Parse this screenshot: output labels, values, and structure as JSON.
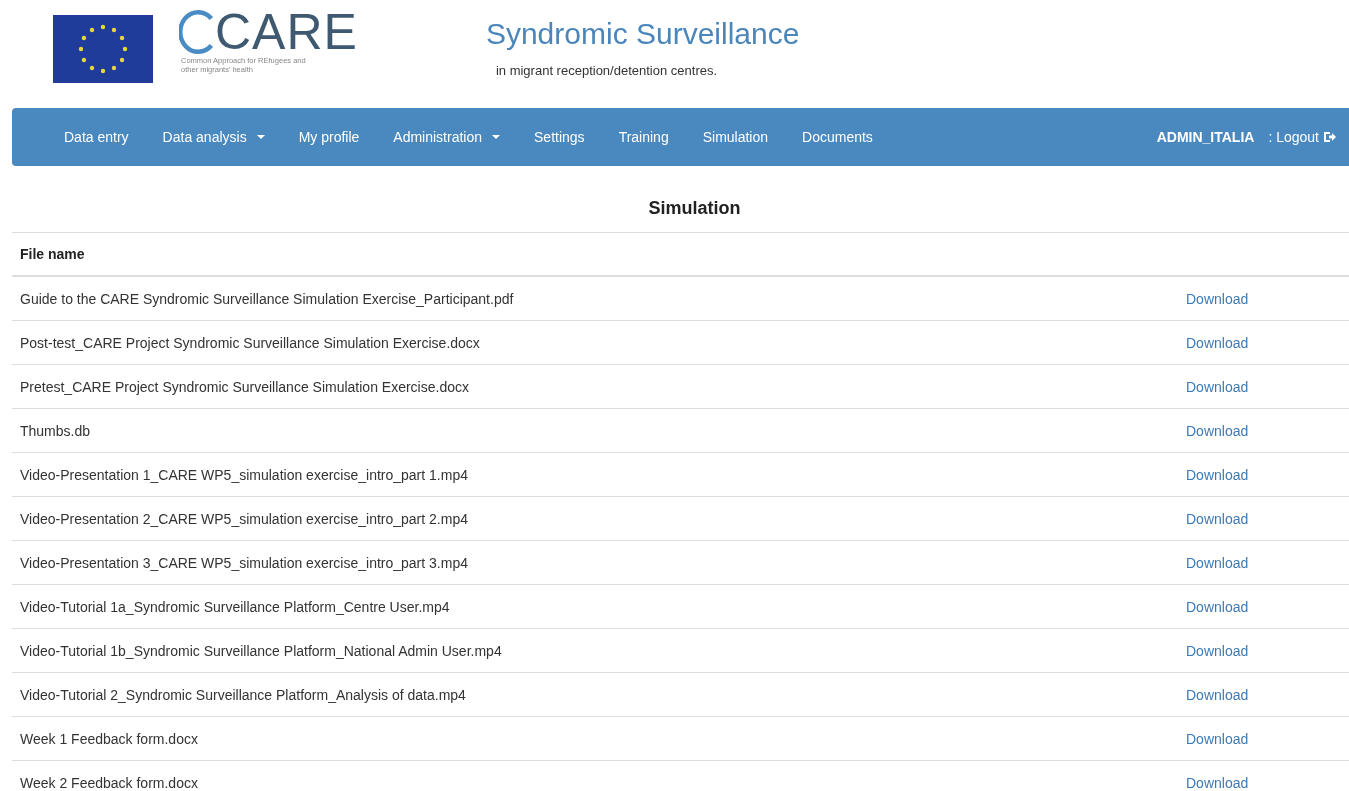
{
  "header": {
    "logo_name": "CARE",
    "logo_tagline": "Common Approach for REfugees and other migrants' health",
    "title": "Syndromic Surveillance",
    "subtitle": "in migrant reception/detention centres."
  },
  "nav": {
    "items": [
      {
        "label": "Data entry",
        "dropdown": false
      },
      {
        "label": "Data analysis",
        "dropdown": true
      },
      {
        "label": "My profile",
        "dropdown": false
      },
      {
        "label": "Administration",
        "dropdown": true
      },
      {
        "label": "Settings",
        "dropdown": false
      },
      {
        "label": "Training",
        "dropdown": false
      },
      {
        "label": "Simulation",
        "dropdown": false
      },
      {
        "label": "Documents",
        "dropdown": false
      }
    ],
    "user": "ADMIN_ITALIA",
    "logout": ": Logout"
  },
  "page_title": "Simulation",
  "table": {
    "columns": [
      "File name"
    ],
    "rows": [
      {
        "file": "Guide to the CARE Syndromic Surveillance Simulation Exercise_Participant.pdf",
        "action": "Download"
      },
      {
        "file": "Post-test_CARE Project Syndromic Surveillance Simulation Exercise.docx",
        "action": "Download"
      },
      {
        "file": "Pretest_CARE Project Syndromic Surveillance Simulation Exercise.docx",
        "action": "Download"
      },
      {
        "file": "Thumbs.db",
        "action": "Download"
      },
      {
        "file": "Video-Presentation 1_CARE WP5_simulation exercise_intro_part 1.mp4",
        "action": "Download"
      },
      {
        "file": "Video-Presentation 2_CARE WP5_simulation exercise_intro_part 2.mp4",
        "action": "Download"
      },
      {
        "file": "Video-Presentation 3_CARE WP5_simulation exercise_intro_part 3.mp4",
        "action": "Download"
      },
      {
        "file": "Video-Tutorial 1a_Syndromic Surveillance Platform_Centre User.mp4",
        "action": "Download"
      },
      {
        "file": "Video-Tutorial 1b_Syndromic Surveillance Platform_National Admin User.mp4",
        "action": "Download"
      },
      {
        "file": "Video-Tutorial 2_Syndromic Surveillance Platform_Analysis of data.mp4",
        "action": "Download"
      },
      {
        "file": "Week 1 Feedback form.docx",
        "action": "Download"
      },
      {
        "file": "Week 2 Feedback form.docx",
        "action": "Download"
      }
    ]
  }
}
